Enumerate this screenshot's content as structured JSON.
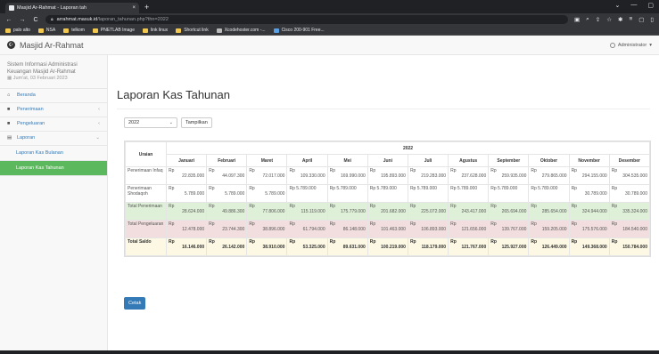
{
  "browser": {
    "tab_title": "Masjid Ar-Rahmat - Laporan tah",
    "tab_close": "×",
    "new_tab": "+",
    "win_controls": [
      "⌄",
      "—",
      "▢"
    ],
    "nav": [
      "←",
      "→",
      "C"
    ],
    "url_host": "arrahmat.masuk.id",
    "url_path": "/laporan_tahunan.php?thn=2022",
    "addr_icons": [
      "▣",
      "⌕",
      "⇪",
      "☆",
      "✱",
      "≡",
      "▢",
      "▯"
    ],
    "bookmarks": [
      "palo alto",
      "NSA",
      "telkom",
      "PNETLAB Image",
      "link linux",
      "Shortcut link",
      "Xcodehoster.com -...",
      "Cisco 200-901 Free..."
    ]
  },
  "header": {
    "brand": "Masjid Ar-Rahmat",
    "user": "Administrator"
  },
  "sidebar": {
    "system_title": "Sistem Informasi Administrasi Keuangan Masjid Ar-Rahmat",
    "date": "Jum'at, 03 Februari 2023",
    "items": [
      {
        "label": "Beranda"
      },
      {
        "label": "Penerimaan",
        "caret": "‹"
      },
      {
        "label": "Pengeluaran",
        "caret": "‹"
      },
      {
        "label": "Laporan",
        "caret": "⌄"
      }
    ],
    "subitems": [
      {
        "label": "Laporan Kas Bulanan"
      },
      {
        "label": "Laporan Kas Tahunan"
      }
    ]
  },
  "main": {
    "title": "Laporan Kas Tahunan",
    "year_selected": "2022",
    "show_button": "Tampilkan",
    "print_button": "Cetak"
  },
  "table": {
    "col_label": "Uraian",
    "year_header": "2022",
    "months": [
      "Januari",
      "Februari",
      "Maret",
      "April",
      "Mei",
      "Juni",
      "Juli",
      "Agustus",
      "September",
      "Oktober",
      "November",
      "Desember"
    ],
    "rows": [
      {
        "label": "Penerimaan Infaq",
        "cells": [
          [
            "Rp",
            "22.835.000"
          ],
          [
            "Rp",
            "44.097.300"
          ],
          [
            "Rp",
            "72.017.000"
          ],
          [
            "Rp",
            "109.330.000"
          ],
          [
            "Rp",
            "169.990.000"
          ],
          [
            "Rp",
            "195.893.000"
          ],
          [
            "Rp",
            "219.283.000"
          ],
          [
            "Rp",
            "237.628.000"
          ],
          [
            "Rp",
            "259.935.000"
          ],
          [
            "Rp",
            "279.865.000"
          ],
          [
            "Rp",
            "294.155.000"
          ],
          [
            "Rp",
            "304.535.000"
          ]
        ]
      },
      {
        "label": "Penerimaan Shodaqoh",
        "cells": [
          [
            "Rp",
            "5.789.000"
          ],
          [
            "Rp",
            "5.789.000"
          ],
          [
            "Rp",
            "5.789.000"
          ],
          [
            "Rp 5.789.000",
            ""
          ],
          [
            "Rp 5.789.000",
            ""
          ],
          [
            "Rp 5.789.000",
            ""
          ],
          [
            "Rp 5.789.000",
            ""
          ],
          [
            "Rp 5.789.000",
            ""
          ],
          [
            "Rp 5.789.000",
            ""
          ],
          [
            "Rp 5.789.000",
            ""
          ],
          [
            "Rp",
            "30.789.000"
          ],
          [
            "Rp",
            "30.789.000"
          ]
        ]
      },
      {
        "label": "Total Penerimaan",
        "cells": [
          [
            "Rp",
            "28.624.000"
          ],
          [
            "Rp",
            "49.886.300"
          ],
          [
            "Rp",
            "77.806.000"
          ],
          [
            "Rp",
            "115.119.000"
          ],
          [
            "Rp",
            "175.779.000"
          ],
          [
            "Rp",
            "201.682.000"
          ],
          [
            "Rp",
            "225.072.000"
          ],
          [
            "Rp",
            "243.417.000"
          ],
          [
            "Rp",
            "265.694.000"
          ],
          [
            "Rp",
            "285.654.000"
          ],
          [
            "Rp",
            "324.944.000"
          ],
          [
            "Rp",
            "335.324.000"
          ]
        ]
      },
      {
        "label": "Total Pengeluaran",
        "cells": [
          [
            "Rp",
            "12.478.000"
          ],
          [
            "Rp",
            "23.744.300"
          ],
          [
            "Rp",
            "38.896.000"
          ],
          [
            "Rp",
            "61.794.000"
          ],
          [
            "Rp",
            "86.148.000"
          ],
          [
            "Rp",
            "101.463.000"
          ],
          [
            "Rp",
            "106.893.000"
          ],
          [
            "Rp",
            "121.656.000"
          ],
          [
            "Rp",
            "139.767.000"
          ],
          [
            "Rp",
            "159.205.000"
          ],
          [
            "Rp",
            "175.576.000"
          ],
          [
            "Rp",
            "184.540.000"
          ]
        ]
      },
      {
        "label": "Total Saldo",
        "cells": [
          [
            "Rp",
            "16.146.000"
          ],
          [
            "Rp",
            "26.142.000"
          ],
          [
            "Rp",
            "38.910.000"
          ],
          [
            "Rp",
            "53.325.000"
          ],
          [
            "Rp",
            "89.631.000"
          ],
          [
            "Rp",
            "100.219.000"
          ],
          [
            "Rp",
            "118.179.000"
          ],
          [
            "Rp",
            "121.767.000"
          ],
          [
            "Rp",
            "125.927.000"
          ],
          [
            "Rp",
            "126.449.000"
          ],
          [
            "Rp",
            "149.368.000"
          ],
          [
            "Rp",
            "150.784.000"
          ]
        ]
      }
    ]
  },
  "colors": {
    "primary": "#337ab7",
    "active_menu": "#5cb85c",
    "total_in_bg": "#dff0d8",
    "total_out_bg": "#f2dede",
    "saldo_bg": "#fcf8e3"
  }
}
